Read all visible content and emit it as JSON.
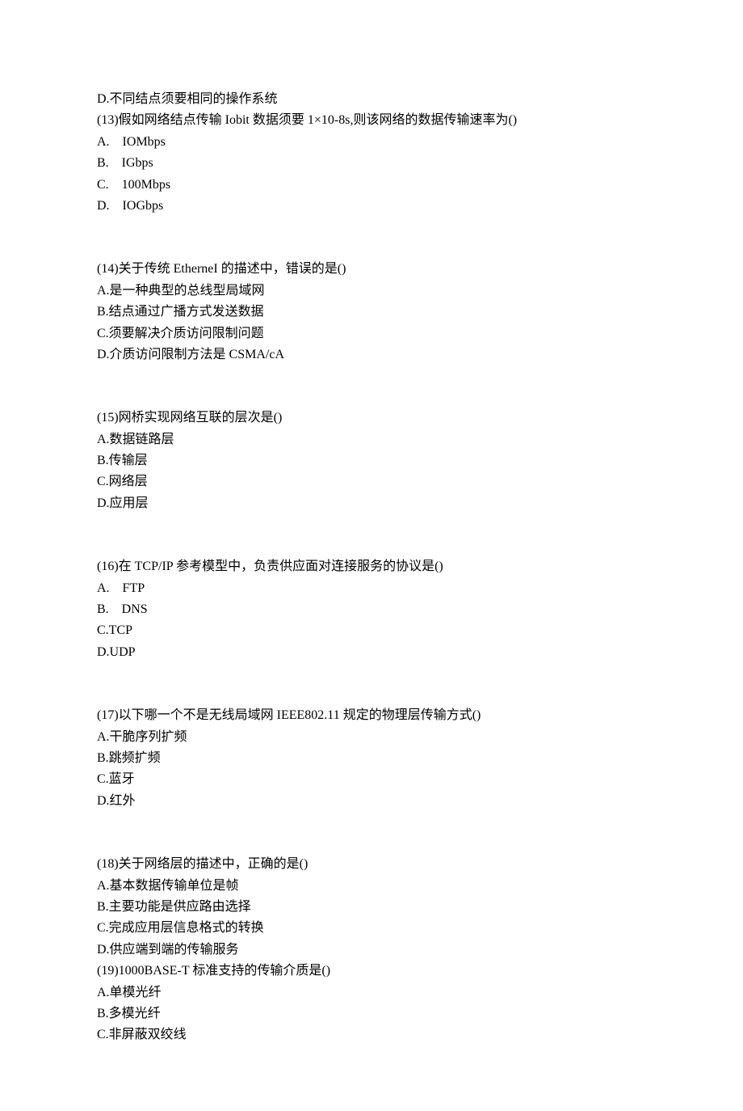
{
  "lines": [
    "D.不同结点须要相同的操作系统",
    "(13)假如网络结点传输 Iobit 数据须要 1×10-8s,则该网络的数据传输速率为()",
    "A.    IOMbps",
    "B.    IGbps",
    "C.    100Mbps",
    "D.    IOGbps",
    "",
    "",
    "(14)关于传统 EtherneI 的描述中，错误的是()",
    "A.是一种典型的总线型局域网",
    "B.结点通过广播方式发送数据",
    "C.须要解决介质访问限制问题",
    "D.介质访问限制方法是 CSMA/cA",
    "",
    "",
    "(15)网桥实现网络互联的层次是()",
    "A.数据链路层",
    "B.传输层",
    "C.网络层",
    "D.应用层",
    "",
    "",
    "(16)在 TCP/IP 参考模型中，负责供应面对连接服务的协议是()",
    "A.    FTP",
    "B.    DNS",
    "C.TCP",
    "D.UDP",
    "",
    "",
    "(17)以下哪一个不是无线局域网 IEEE802.11 规定的物理层传输方式()",
    "A.干脆序列扩频",
    "B.跳频扩频",
    "C.蓝牙",
    "D.红外",
    "",
    "",
    "(18)关于网络层的描述中，正确的是()",
    "A.基本数据传输单位是帧",
    "B.主要功能是供应路由选择",
    "C.完成应用层信息格式的转换",
    "D.供应端到端的传输服务",
    "(19)1000BASE-T 标准支持的传输介质是()",
    "A.单模光纤",
    "B.多模光纤",
    "C.非屏蔽双绞线"
  ]
}
